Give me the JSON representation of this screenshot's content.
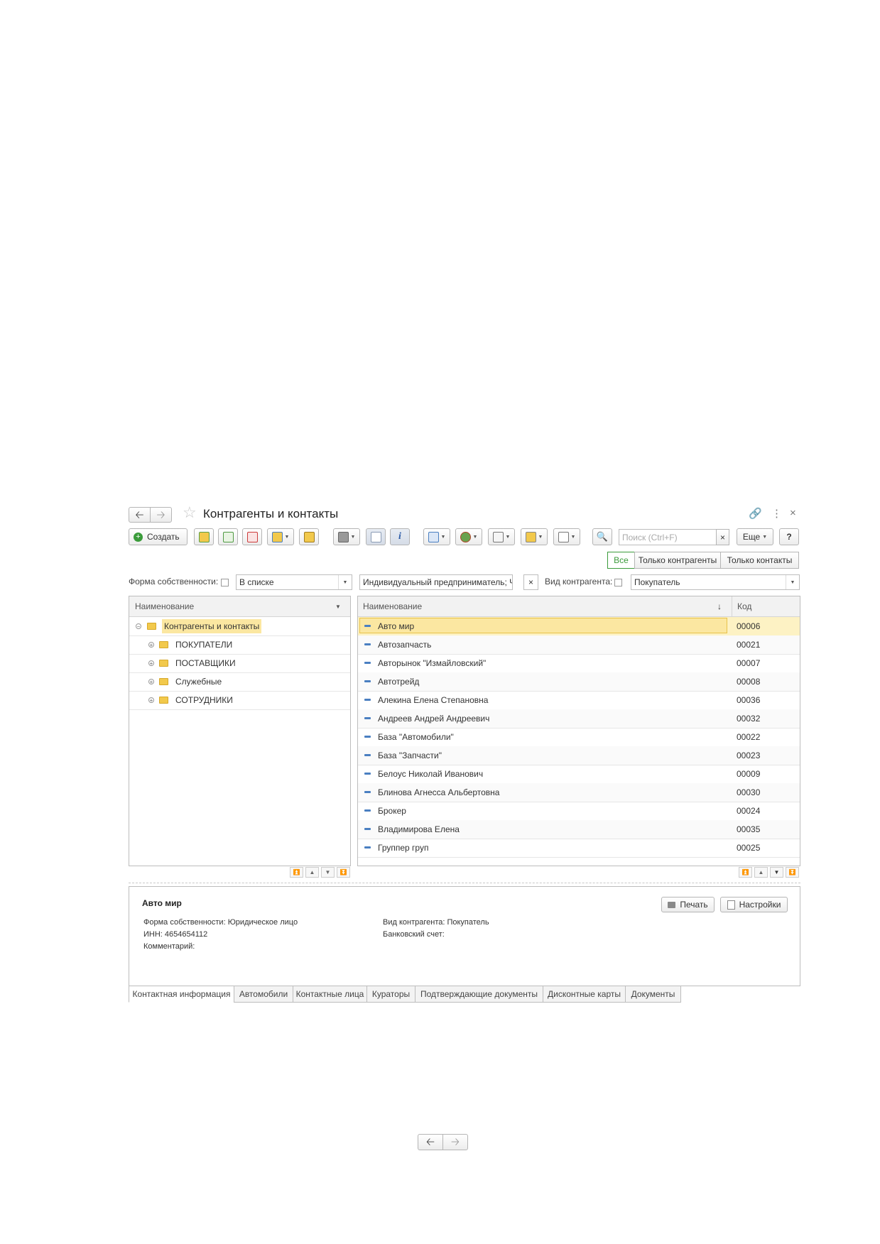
{
  "window": {
    "title": "Контрагенты и контакты",
    "icons": [
      "back-arrow-icon",
      "forward-arrow-icon",
      "star-icon",
      "link-icon",
      "more-icon",
      "close-icon"
    ]
  },
  "toolbar": {
    "create_label": "Создать",
    "search_placeholder": "Поиск (Ctrl+F)",
    "search_clear": "×",
    "more_label": "Еще",
    "help_label": "?"
  },
  "view_switch": {
    "options": [
      "Все",
      "Только контрагенты",
      "Только контакты"
    ],
    "selected": "Все"
  },
  "filters": {
    "ownership_label": "Форма собственности:",
    "ownership_mode": "В списке",
    "ownership_value": "Индивидуальный предприниматель; Ч",
    "kind_label": "Вид контрагента:",
    "kind_value": "Покупатель",
    "clear": "×"
  },
  "groups_tree": {
    "header": "Наименование",
    "root": "Контрагенты и контакты",
    "items": [
      "ПОКУПАТЕЛИ",
      "ПОСТАВЩИКИ",
      "Служебные",
      "СОТРУДНИКИ"
    ]
  },
  "list": {
    "columns": [
      "Наименование",
      "Код"
    ],
    "sort_indicator": "↓",
    "rows": [
      {
        "name": "Авто мир",
        "code": "00006"
      },
      {
        "name": "Автозапчасть",
        "code": "00021"
      },
      {
        "name": "Авторынок \"Измайловский\"",
        "code": "00007"
      },
      {
        "name": "Автотрейд",
        "code": "00008"
      },
      {
        "name": "Алекина Елена Степановна",
        "code": "00036"
      },
      {
        "name": "Андреев Андрей Андреевич",
        "code": "00032"
      },
      {
        "name": "База \"Автомобили\"",
        "code": "00022"
      },
      {
        "name": "База \"Запчасти\"",
        "code": "00023"
      },
      {
        "name": "Белоус Николай Иванович",
        "code": "00009"
      },
      {
        "name": "Блинова Агнесса Альбертовна",
        "code": "00030"
      },
      {
        "name": "Брокер",
        "code": "00024"
      },
      {
        "name": "Владимирова Елена",
        "code": "00035"
      },
      {
        "name": "Группер груп",
        "code": "00025"
      }
    ],
    "selected_index": 0
  },
  "details": {
    "title": "Авто мир",
    "print_label": "Печать",
    "settings_label": "Настройки",
    "ownership": "Форма собственности: Юридическое лицо",
    "inn": "ИНН: 4654654112",
    "comment": "Комментарий:",
    "kind": "Вид контрагента: Покупатель",
    "bank_account": "Банковский счет:"
  },
  "tabs": [
    "Контактная информация",
    "Автомобили",
    "Контактные лица",
    "Кураторы",
    "Подтверждающие документы",
    "Дисконтные карты",
    "Документы"
  ],
  "active_tab": 0,
  "colors": {
    "selection": "#fbe7a1",
    "selection_border": "#e8c24a",
    "accent_green": "#3a9b3a",
    "folder": "#f2c94c",
    "item_marker": "#4a7fc1"
  }
}
